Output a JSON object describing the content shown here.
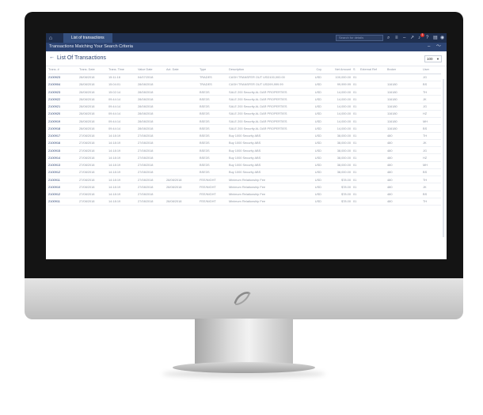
{
  "app": {
    "tab_label": "List of transactions",
    "search_placeholder": "Search for details",
    "subtitle": "Transactions Matching Your Search Criteria",
    "notification_count": "1"
  },
  "page": {
    "title": "List Of Transactions",
    "page_size": "100"
  },
  "table": {
    "columns": [
      "Trans. #",
      "Trans. Date",
      "Trans. Time",
      "Value Date",
      "Act. Date",
      "Type",
      "Description",
      "Ccy",
      "Net Amount",
      "S",
      "External Ref",
      "Broker",
      "User"
    ],
    "rows": [
      [
        "2100923",
        "28/08/2018",
        "15:11:18",
        "04/07/2018",
        "",
        "TRADES",
        "CASH TRANSFER OUT USD100,000.00",
        "USD",
        "100,000.00",
        "01",
        "",
        "",
        "JG"
      ],
      [
        "2100904",
        "28/08/2018",
        "15:04:01",
        "28/08/2018",
        "",
        "TRADES",
        "CASH TRANSFER OUT USD99,999.99",
        "USD",
        "99,999.99",
        "01",
        "",
        "116180",
        "BS"
      ],
      [
        "2100923",
        "28/08/2018",
        "15:02:14",
        "28/08/2018",
        "",
        "BSE3S",
        "SALE 200 Security AL DAR PROPERTIES",
        "USD",
        "14,000.00",
        "01",
        "",
        "116180",
        "TH"
      ],
      [
        "2100922",
        "28/08/2018",
        "09:44:14",
        "28/08/2018",
        "",
        "BSE3S",
        "SALE 200 Security AL DAR PROPERTIES",
        "USD",
        "14,000.00",
        "01",
        "",
        "116180",
        "JK"
      ],
      [
        "2100921",
        "28/08/2018",
        "09:44:14",
        "28/08/2018",
        "",
        "BSE3S",
        "SALE 200 Security AL DAR PROPERTIES",
        "USD",
        "14,000.00",
        "01",
        "",
        "116180",
        "JG"
      ],
      [
        "2100920",
        "28/08/2018",
        "09:44:14",
        "28/08/2018",
        "",
        "BSE3S",
        "SALE 200 Security AL DAR PROPERTIES",
        "USD",
        "14,000.00",
        "01",
        "",
        "116180",
        "HZ"
      ],
      [
        "2100919",
        "28/08/2018",
        "09:44:14",
        "28/08/2018",
        "",
        "BSE3S",
        "SALE 200 Security AL DAR PROPERTIES",
        "USD",
        "14,000.00",
        "01",
        "",
        "116180",
        "MH"
      ],
      [
        "2100918",
        "28/08/2018",
        "09:44:14",
        "28/08/2018",
        "",
        "BSE3S",
        "SALE 200 Security AL DAR PROPERTIES",
        "USD",
        "14,000.00",
        "01",
        "",
        "116180",
        "BS"
      ],
      [
        "2100917",
        "27/08/2018",
        "14:18:19",
        "27/08/2018",
        "",
        "BSE3S",
        "Buy 1000 Security ABS",
        "USD",
        "38,000.00",
        "01",
        "",
        "480",
        "TH"
      ],
      [
        "2100916",
        "27/08/2018",
        "14:18:19",
        "27/08/2018",
        "",
        "BSE3S",
        "Buy 1000 Security ABS",
        "USD",
        "38,000.00",
        "01",
        "",
        "480",
        "JK"
      ],
      [
        "2100915",
        "27/08/2018",
        "14:18:19",
        "27/08/2018",
        "",
        "BSE3S",
        "Buy 1000 Security ABS",
        "USD",
        "38,000.00",
        "01",
        "",
        "480",
        "JG"
      ],
      [
        "2100914",
        "27/08/2018",
        "14:18:19",
        "27/08/2018",
        "",
        "BSE3S",
        "Buy 1000 Security ABS",
        "USD",
        "38,000.00",
        "01",
        "",
        "480",
        "HZ"
      ],
      [
        "2100913",
        "27/08/2018",
        "14:18:19",
        "27/08/2018",
        "",
        "BSE3S",
        "Buy 1000 Security ABS",
        "USD",
        "38,000.00",
        "01",
        "",
        "480",
        "MH"
      ],
      [
        "2100912",
        "27/08/2018",
        "14:18:19",
        "27/08/2018",
        "",
        "BSE3S",
        "Buy 1000 Security ABS",
        "USD",
        "38,000.00",
        "01",
        "",
        "480",
        "BS"
      ],
      [
        "2100911",
        "27/08/2018",
        "14:18:19",
        "27/08/2018",
        "28/08/2018",
        "FEE/NIGHT",
        "Minimum Relationship Fee",
        "USD",
        "$78.00",
        "01",
        "",
        "480",
        "TH"
      ],
      [
        "2100910",
        "27/08/2018",
        "14:18:19",
        "27/08/2018",
        "28/08/2018",
        "FEE/NIGHT",
        "Minimum Relationship Fee",
        "USD",
        "$78.00",
        "01",
        "",
        "480",
        "JK"
      ],
      [
        "2100912",
        "27/08/2018",
        "14:18:19",
        "27/08/2018",
        "",
        "FEE/NIGHT",
        "Minimum Relationship Fee",
        "USD",
        "$78.00",
        "01",
        "",
        "480",
        "BS"
      ],
      [
        "2100911",
        "27/08/2018",
        "14:18:19",
        "27/08/2018",
        "28/08/2018",
        "FEE/NIGHT",
        "Minimum Relationship Fee",
        "USD",
        "$78.00",
        "01",
        "",
        "480",
        "TH"
      ]
    ]
  }
}
